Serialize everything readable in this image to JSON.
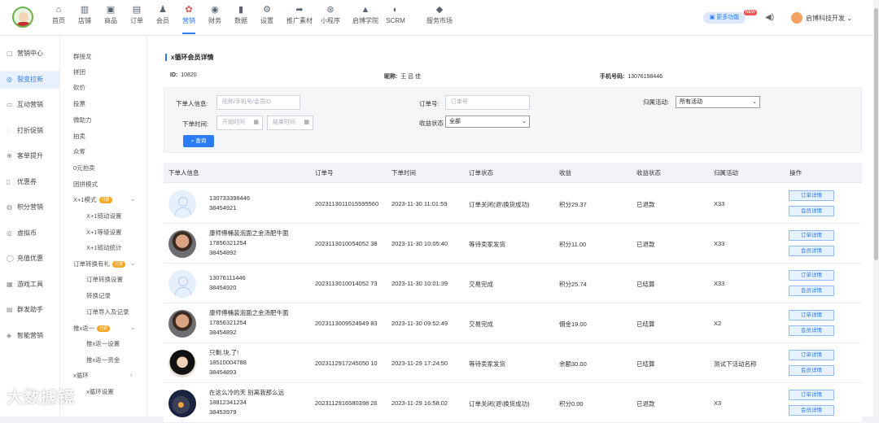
{
  "nav": [
    {
      "icon": "home-icon",
      "glyph": "⌂",
      "label": "首页"
    },
    {
      "icon": "store-icon",
      "glyph": "▥",
      "label": "店铺"
    },
    {
      "icon": "goods-icon",
      "glyph": "▣",
      "label": "商品"
    },
    {
      "icon": "order-icon",
      "glyph": "▤",
      "label": "订单"
    },
    {
      "icon": "member-icon",
      "glyph": "♟",
      "label": "会员"
    },
    {
      "icon": "marketing-icon",
      "glyph": "✿",
      "label": "营销"
    },
    {
      "icon": "finance-icon",
      "glyph": "◉",
      "label": "财务"
    },
    {
      "icon": "data-icon",
      "glyph": "▮",
      "label": "数据"
    },
    {
      "icon": "settings-icon",
      "glyph": "⚙",
      "label": "设置"
    },
    {
      "icon": "share-icon",
      "glyph": "➦",
      "label": "推广素材"
    },
    {
      "icon": "miniprogram-icon",
      "glyph": "⊛",
      "label": "小程序"
    },
    {
      "icon": "academy-icon",
      "glyph": "▲",
      "label": "启博学院"
    },
    {
      "icon": "scrm-icon",
      "glyph": "◐",
      "label": "SCRM"
    },
    {
      "icon": "service-market-icon",
      "glyph": "◆",
      "label": "服务市场"
    }
  ],
  "header": {
    "more_label": "更多功能",
    "new_badge": "NEW",
    "user_name": "启博科技开发"
  },
  "sidebar1": [
    {
      "icon": "marketing-center-icon",
      "glyph": "▢",
      "label": "营销中心"
    },
    {
      "icon": "fission-icon",
      "glyph": "◎",
      "label": "裂变拉新"
    },
    {
      "icon": "interactive-icon",
      "glyph": "▭",
      "label": "互动营销"
    },
    {
      "icon": "discount-icon",
      "glyph": "◌",
      "label": "打折促销"
    },
    {
      "icon": "upsell-icon",
      "glyph": "⊕",
      "label": "客单提升"
    },
    {
      "icon": "coupon-icon",
      "glyph": "▯",
      "label": "优惠券"
    },
    {
      "icon": "points-icon",
      "glyph": "◍",
      "label": "积分营销"
    },
    {
      "icon": "virtual-coin-icon",
      "glyph": "◎",
      "label": "虚拟币"
    },
    {
      "icon": "recharge-icon",
      "glyph": "◯",
      "label": "充值优惠"
    },
    {
      "icon": "game-icon",
      "glyph": "▦",
      "label": "游戏工具"
    },
    {
      "icon": "group-send-icon",
      "glyph": "▤",
      "label": "群发助手"
    },
    {
      "icon": "smart-marketing-icon",
      "glyph": "◈",
      "label": "智能营销"
    }
  ],
  "sidebar2": [
    {
      "label": "群接龙"
    },
    {
      "label": "拼团"
    },
    {
      "label": "砍价"
    },
    {
      "label": "投票"
    },
    {
      "label": "微助力"
    },
    {
      "label": "拍卖"
    },
    {
      "label": "众筹"
    },
    {
      "label": "0元拍卖"
    },
    {
      "label": "团拼模式"
    },
    {
      "label": "X+1模式",
      "badge": "付费",
      "chevron": "⌄"
    },
    {
      "label": "X+1链动设置",
      "sub": true
    },
    {
      "label": "X+1等级设置",
      "sub": true
    },
    {
      "label": "X+1链动统计",
      "sub": true
    },
    {
      "label": "订单转换有礼",
      "badge": "付费",
      "chevron": "⌄"
    },
    {
      "label": "订单转换设置",
      "sub": true
    },
    {
      "label": "转换记录",
      "sub": true
    },
    {
      "label": "订单导入及记录",
      "sub": true
    },
    {
      "label": "推x返一",
      "badge": "付费",
      "chevron": "⌄"
    },
    {
      "label": "推x返一设置",
      "sub": true
    },
    {
      "label": "推x返一资金",
      "sub": true
    },
    {
      "label": "x循环",
      "chevron": "›"
    },
    {
      "label": "x循环设置",
      "sub": true
    }
  ],
  "watermark": "大数據镜",
  "page": {
    "title": "x循环会员详情",
    "id_label": "ID:",
    "id_value": "10820",
    "nickname_label": "昵称:",
    "nickname_value": "王 吕 佳",
    "phone_label": "手机号码:",
    "phone_value": "13076198446"
  },
  "filter": {
    "buyer_label": "下单人信息:",
    "buyer_placeholder": "昵称/手机号/会员ID",
    "order_no_label": "订单号:",
    "order_no_placeholder": "订单号",
    "activity_label": "归属活动:",
    "activity_value": "所有活动",
    "time_label": "下单时间:",
    "start_placeholder": "开始时间",
    "end_placeholder": "结束时间",
    "income_status_label": "收益状态",
    "income_status_value": "全部",
    "search_label": "查询"
  },
  "table": {
    "headers": [
      "下单人信息",
      "订单号",
      "下单时间",
      "订单状态",
      "收益",
      "收益状态",
      "归属活动",
      "操作"
    ],
    "detail_btn": "订单详情",
    "member_btn": "会员详情",
    "rows": [
      {
        "avatar": "default",
        "name": "",
        "phone": "130733398446",
        "member_id": "38454921",
        "order_no": "2023113011015595560",
        "time": "2023-11-30 11:01:59",
        "status": "订单关闭(退\\换货成功)",
        "income": "积分29.37",
        "income_status": "已退款",
        "activity": "X33"
      },
      {
        "avatar": "photo1",
        "name": "康师傅桶装泡面之金汤肥牛面",
        "phone": "17856321254",
        "member_id": "38454892",
        "order_no": "2023113010054052 38",
        "time": "2023-11-30 10:05:40",
        "status": "等待卖家发货",
        "income": "积分11.00",
        "income_status": "已退款",
        "activity": "X33"
      },
      {
        "avatar": "default",
        "name": "",
        "phone": "13076111446",
        "member_id": "38454920",
        "order_no": "2023113010014052 73",
        "time": "2023-11-30 10:01:39",
        "status": "交易完成",
        "income": "积分25.74",
        "income_status": "已结算",
        "activity": "X33"
      },
      {
        "avatar": "photo1",
        "name": "康师傅桶装泡面之金汤肥牛面",
        "phone": "17856321254",
        "member_id": "38454892",
        "order_no": "2023113009524949 83",
        "time": "2023-11-30 09:52:49",
        "status": "交易完成",
        "income": "佣金19.00",
        "income_status": "已结算",
        "activity": "X2"
      },
      {
        "avatar": "photo2",
        "name": "只剩.块,了!",
        "phone": "18510004788",
        "member_id": "38454893",
        "order_no": "2023112917245050 10",
        "time": "2023-11-29 17:24:50",
        "status": "等待卖家发货",
        "income": "余额30.00",
        "income_status": "已结算",
        "activity": "测试下活动名称"
      },
      {
        "avatar": "photo3",
        "name": "在这么冷的天 别离我那么远",
        "phone": "18812341234",
        "member_id": "38453979",
        "order_no": "2023112916580398 26",
        "time": "2023-11-29 16:58:02",
        "status": "订单关闭(退\\换货成功)",
        "income": "积分0.00",
        "income_status": "已退款",
        "activity": "X3"
      }
    ]
  }
}
